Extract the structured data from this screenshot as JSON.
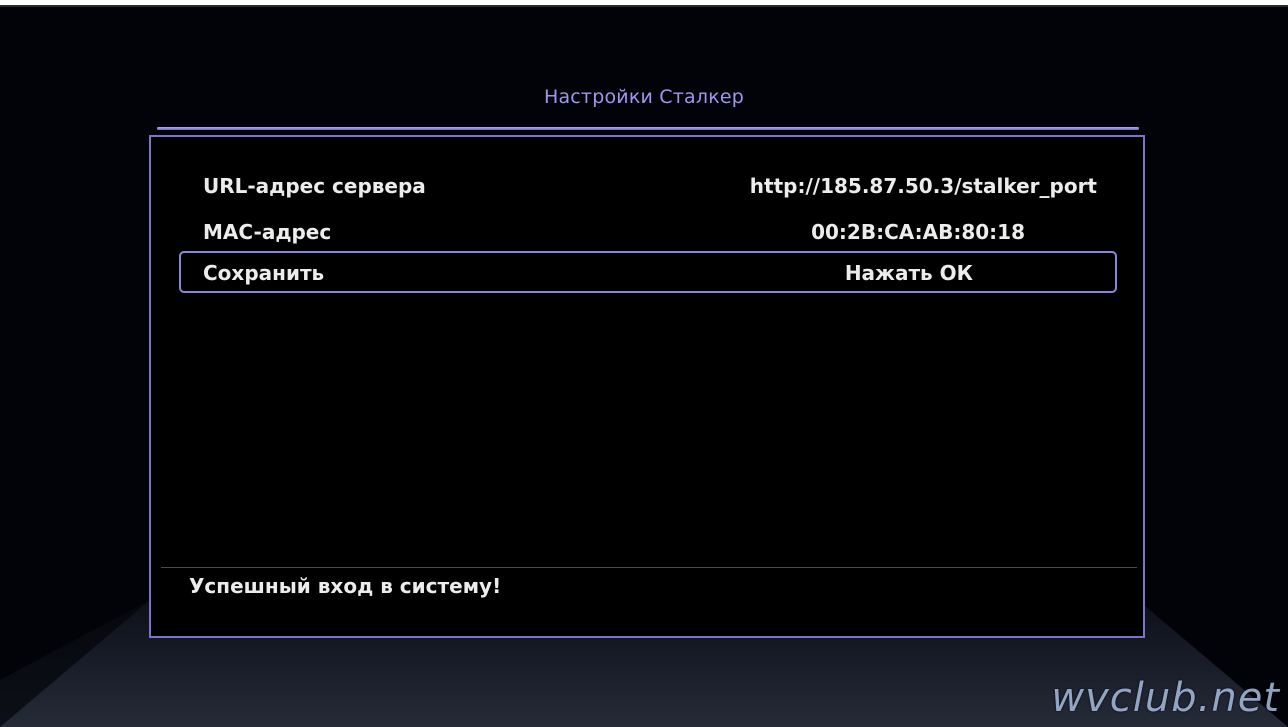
{
  "dialog": {
    "title": "Настройки Сталкер",
    "rows": [
      {
        "label": "URL-адрес сервера",
        "value": "http://185.87.50.3/stalker_port"
      },
      {
        "label": "MAC-адрес",
        "value": "00:2B:CA:AB:80:18"
      },
      {
        "label": "Сохранить",
        "value": "Нажать ОК"
      }
    ],
    "status": "Успешный вход в систему!"
  },
  "watermark": "wvclub.net",
  "colors": {
    "accent": "#9f96ef",
    "border": "#7b74c9",
    "text": "#ececec",
    "background": "#000000"
  }
}
